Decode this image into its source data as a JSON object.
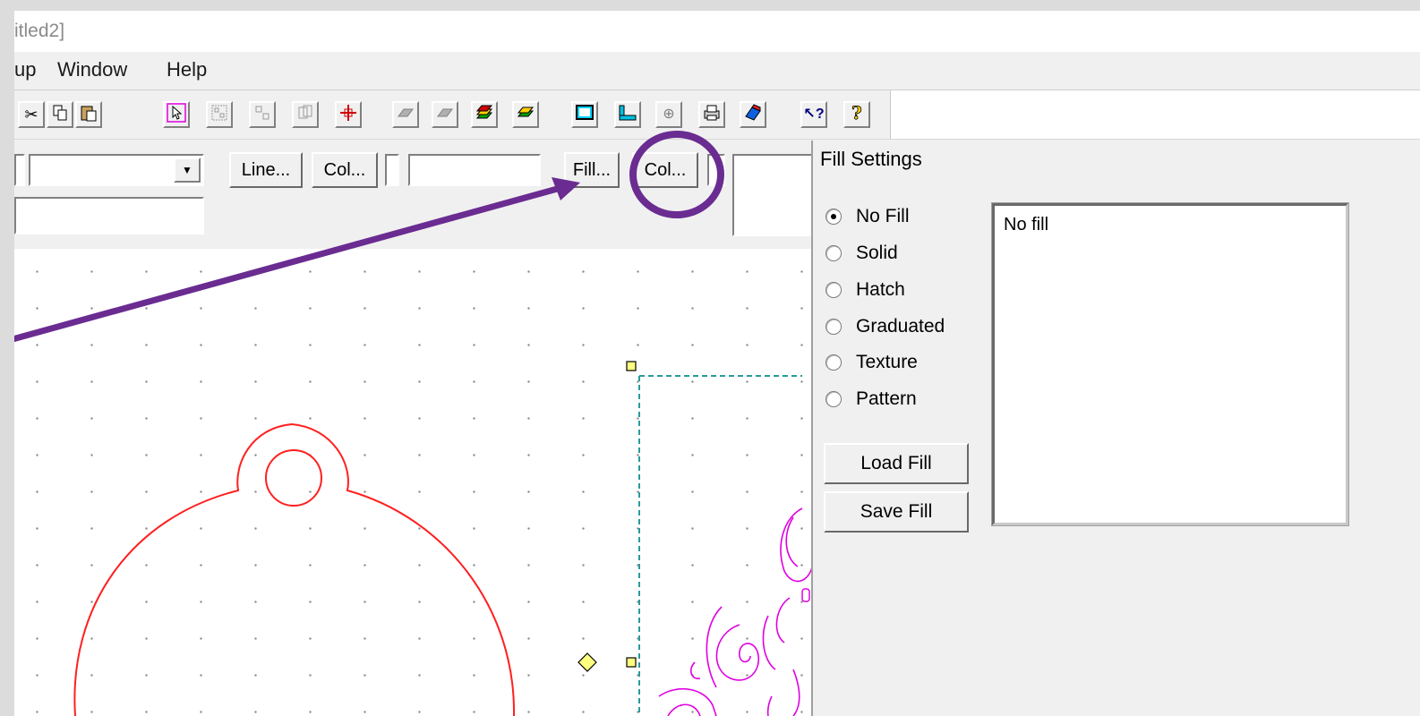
{
  "window": {
    "title_fragment": "itled2]"
  },
  "menu": [
    {
      "label": "up"
    },
    {
      "label": "Window"
    },
    {
      "label": "Help"
    }
  ],
  "toolbar": {
    "icons": [
      {
        "name": "cut-icon",
        "glyph": "✂"
      },
      {
        "name": "copy-icon",
        "glyph": "⎘"
      },
      {
        "name": "paste-icon",
        "glyph": "📋"
      },
      {
        "name": "select-arrow-icon",
        "glyph": "↖"
      },
      {
        "name": "group-icon",
        "glyph": "▦"
      },
      {
        "name": "ungroup-icon",
        "glyph": "▤"
      },
      {
        "name": "rotate-icon",
        "glyph": "⟳"
      },
      {
        "name": "move-cross-icon",
        "glyph": "✛"
      },
      {
        "name": "layer-front-icon",
        "glyph": "▰"
      },
      {
        "name": "layer-back-icon",
        "glyph": "▱"
      },
      {
        "name": "layers-icon",
        "glyph": "≣"
      },
      {
        "name": "layers-edit-icon",
        "glyph": "✎"
      },
      {
        "name": "page-frame-icon",
        "glyph": "▭"
      },
      {
        "name": "ruler-icon",
        "glyph": "⌊"
      },
      {
        "name": "crosshair-icon",
        "glyph": "⊕"
      },
      {
        "name": "print-icon",
        "glyph": "⎙"
      },
      {
        "name": "preview-3d-icon",
        "glyph": "◆"
      },
      {
        "name": "context-help-icon",
        "glyph": "↖?"
      },
      {
        "name": "help-icon",
        "glyph": "?"
      }
    ]
  },
  "properties_bar": {
    "line_button": "Line...",
    "line_color_button": "Col...",
    "fill_button": "Fill...",
    "fill_color_button": "Col..."
  },
  "fill_settings": {
    "title": "Fill Settings",
    "options": [
      {
        "label": "No Fill",
        "checked": true
      },
      {
        "label": "Solid",
        "checked": false
      },
      {
        "label": "Hatch",
        "checked": false
      },
      {
        "label": "Graduated",
        "checked": false
      },
      {
        "label": "Texture",
        "checked": false
      },
      {
        "label": "Pattern",
        "checked": false
      }
    ],
    "load_button": "Load Fill",
    "save_button": "Save Fill",
    "preview_text": "No fill"
  },
  "colors": {
    "annotation": "#6a2c91",
    "shape_outline": "#ff2020",
    "pattern": "#e000e0",
    "selection_dashed": "#2a9a9a",
    "handle_fill": "#ffff80"
  }
}
